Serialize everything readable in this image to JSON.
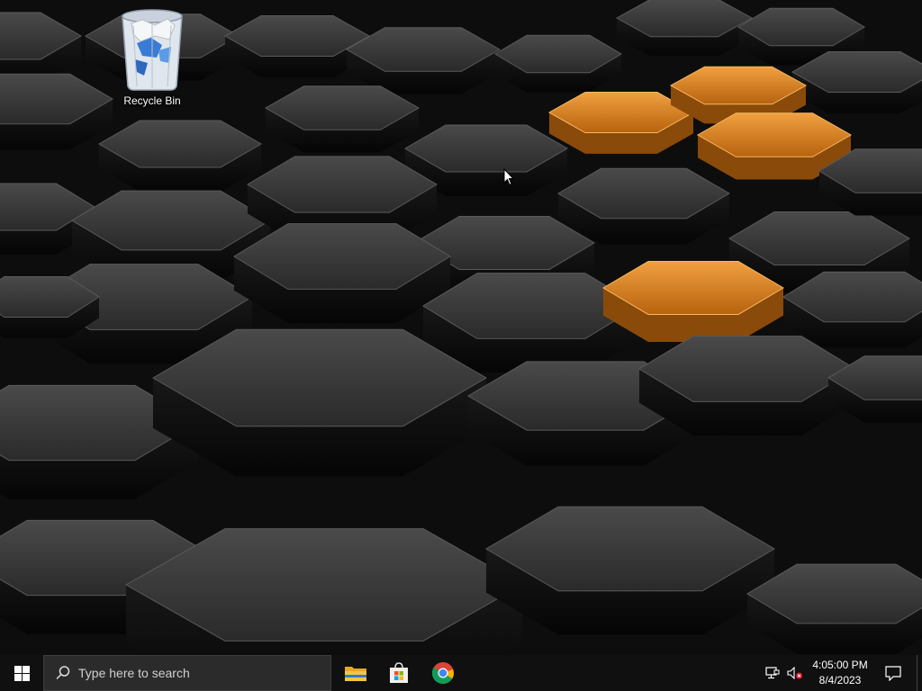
{
  "desktop": {
    "icons": [
      {
        "label": "Recycle Bin",
        "icon": "recycle-bin-icon"
      }
    ],
    "wallpaper": {
      "description_colors": {
        "base": "#1c1c1c",
        "accent": "#e08a1e"
      }
    }
  },
  "taskbar": {
    "start_icon": "windows-logo-icon",
    "search": {
      "placeholder": "Type here to search",
      "icon": "search-icon"
    },
    "pinned_apps": [
      {
        "name": "File Explorer",
        "icon": "folder-icon"
      },
      {
        "name": "Microsoft Store",
        "icon": "store-bag-icon"
      },
      {
        "name": "Google Chrome",
        "icon": "chrome-icon"
      }
    ],
    "tray": {
      "network_icon": "network-icon",
      "volume_icon": "volume-muted-icon"
    },
    "clock": {
      "time": "4:05:00 PM",
      "date": "8/4/2023"
    },
    "notifications_icon": "notification-icon"
  },
  "colors": {
    "taskbar_bg": "#101010",
    "search_bg": "#2b2b2b",
    "accent_orange": "#e08a1e",
    "windows_blue": "#ffffff"
  }
}
